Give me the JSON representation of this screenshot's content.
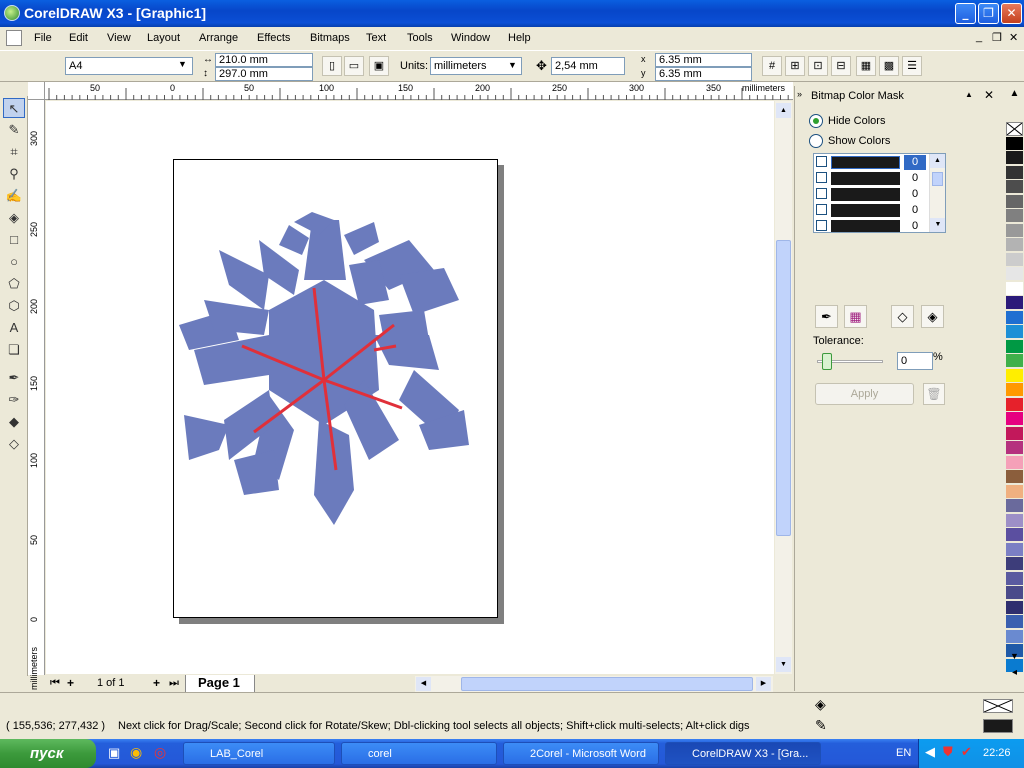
{
  "window": {
    "title": "CorelDRAW X3 - [Graphic1]"
  },
  "menu": [
    "File",
    "Edit",
    "View",
    "Layout",
    "Arrange",
    "Effects",
    "Bitmaps",
    "Text",
    "Tools",
    "Window",
    "Help"
  ],
  "propbar": {
    "paper_size": "A4",
    "width": "210.0 mm",
    "height": "297.0 mm",
    "units_label": "Units:",
    "units_value": "millimeters",
    "nudge": "2,54 mm",
    "dup_x": "6.35 mm",
    "dup_y": "6.35 mm",
    "dup_x_label": "x",
    "dup_y_label": "y"
  },
  "rulers": {
    "h_ticks": [
      "50",
      "0",
      "50",
      "100",
      "150",
      "200",
      "250",
      "300",
      "350",
      "millimeters"
    ],
    "v_ticks": [
      "300",
      "250",
      "200",
      "150",
      "100",
      "50",
      "0",
      "millimeters"
    ]
  },
  "page_nav": {
    "count": "1 of 1",
    "tab": "Page 1"
  },
  "docker": {
    "title": "Bitmap Color Mask",
    "hide_colors": "Hide Colors",
    "show_colors": "Show Colors",
    "color_rows": [
      {
        "tolerance": "0",
        "selected": true
      },
      {
        "tolerance": "0",
        "selected": false
      },
      {
        "tolerance": "0",
        "selected": false
      },
      {
        "tolerance": "0",
        "selected": false
      },
      {
        "tolerance": "0",
        "selected": false
      }
    ],
    "tolerance_label": "Tolerance:",
    "tolerance_value": "0",
    "percent": "%",
    "apply": "Apply"
  },
  "palette": [
    "#ffffff",
    "#000000",
    "#1a1a1a",
    "#333333",
    "#4d4d4d",
    "#666666",
    "#808080",
    "#999999",
    "#b3b3b3",
    "#cccccc",
    "#e6e6e6",
    "#ffffff",
    "#2b1a7a",
    "#1f6fd1",
    "#1e90d6",
    "#009944",
    "#3fb04a",
    "#ffee00",
    "#ff9900",
    "#e6212b",
    "#e60080",
    "#c2185b",
    "#b5317e",
    "#f5a0b8",
    "#8b5e3c",
    "#f0b080",
    "#6a6a9c",
    "#9d8fc7",
    "#5b4fa0",
    "#7b7fc4",
    "#3d3d7a",
    "#5a5aa0",
    "#4a4a8a",
    "#2e2e6e",
    "#3a5fb0",
    "#6a8ad0",
    "#1f5aa8",
    "#0a7bd0"
  ],
  "status": {
    "coords": "( 155,536; 277,432 )",
    "hint": "Next click for Drag/Scale; Second click for Rotate/Skew; Dbl-clicking tool selects all objects; Shift+click multi-selects; Alt+click digs"
  },
  "taskbar": {
    "start": "пуск",
    "tasks": [
      "LAB_Corel",
      "corel",
      "2Corel - Microsoft Word",
      "CorelDRAW X3 - [Gra..."
    ],
    "lang": "EN",
    "clock": "22:26"
  },
  "colors": {
    "snowflake": "#6b7bbd",
    "guide_lines": "#e0303a"
  }
}
